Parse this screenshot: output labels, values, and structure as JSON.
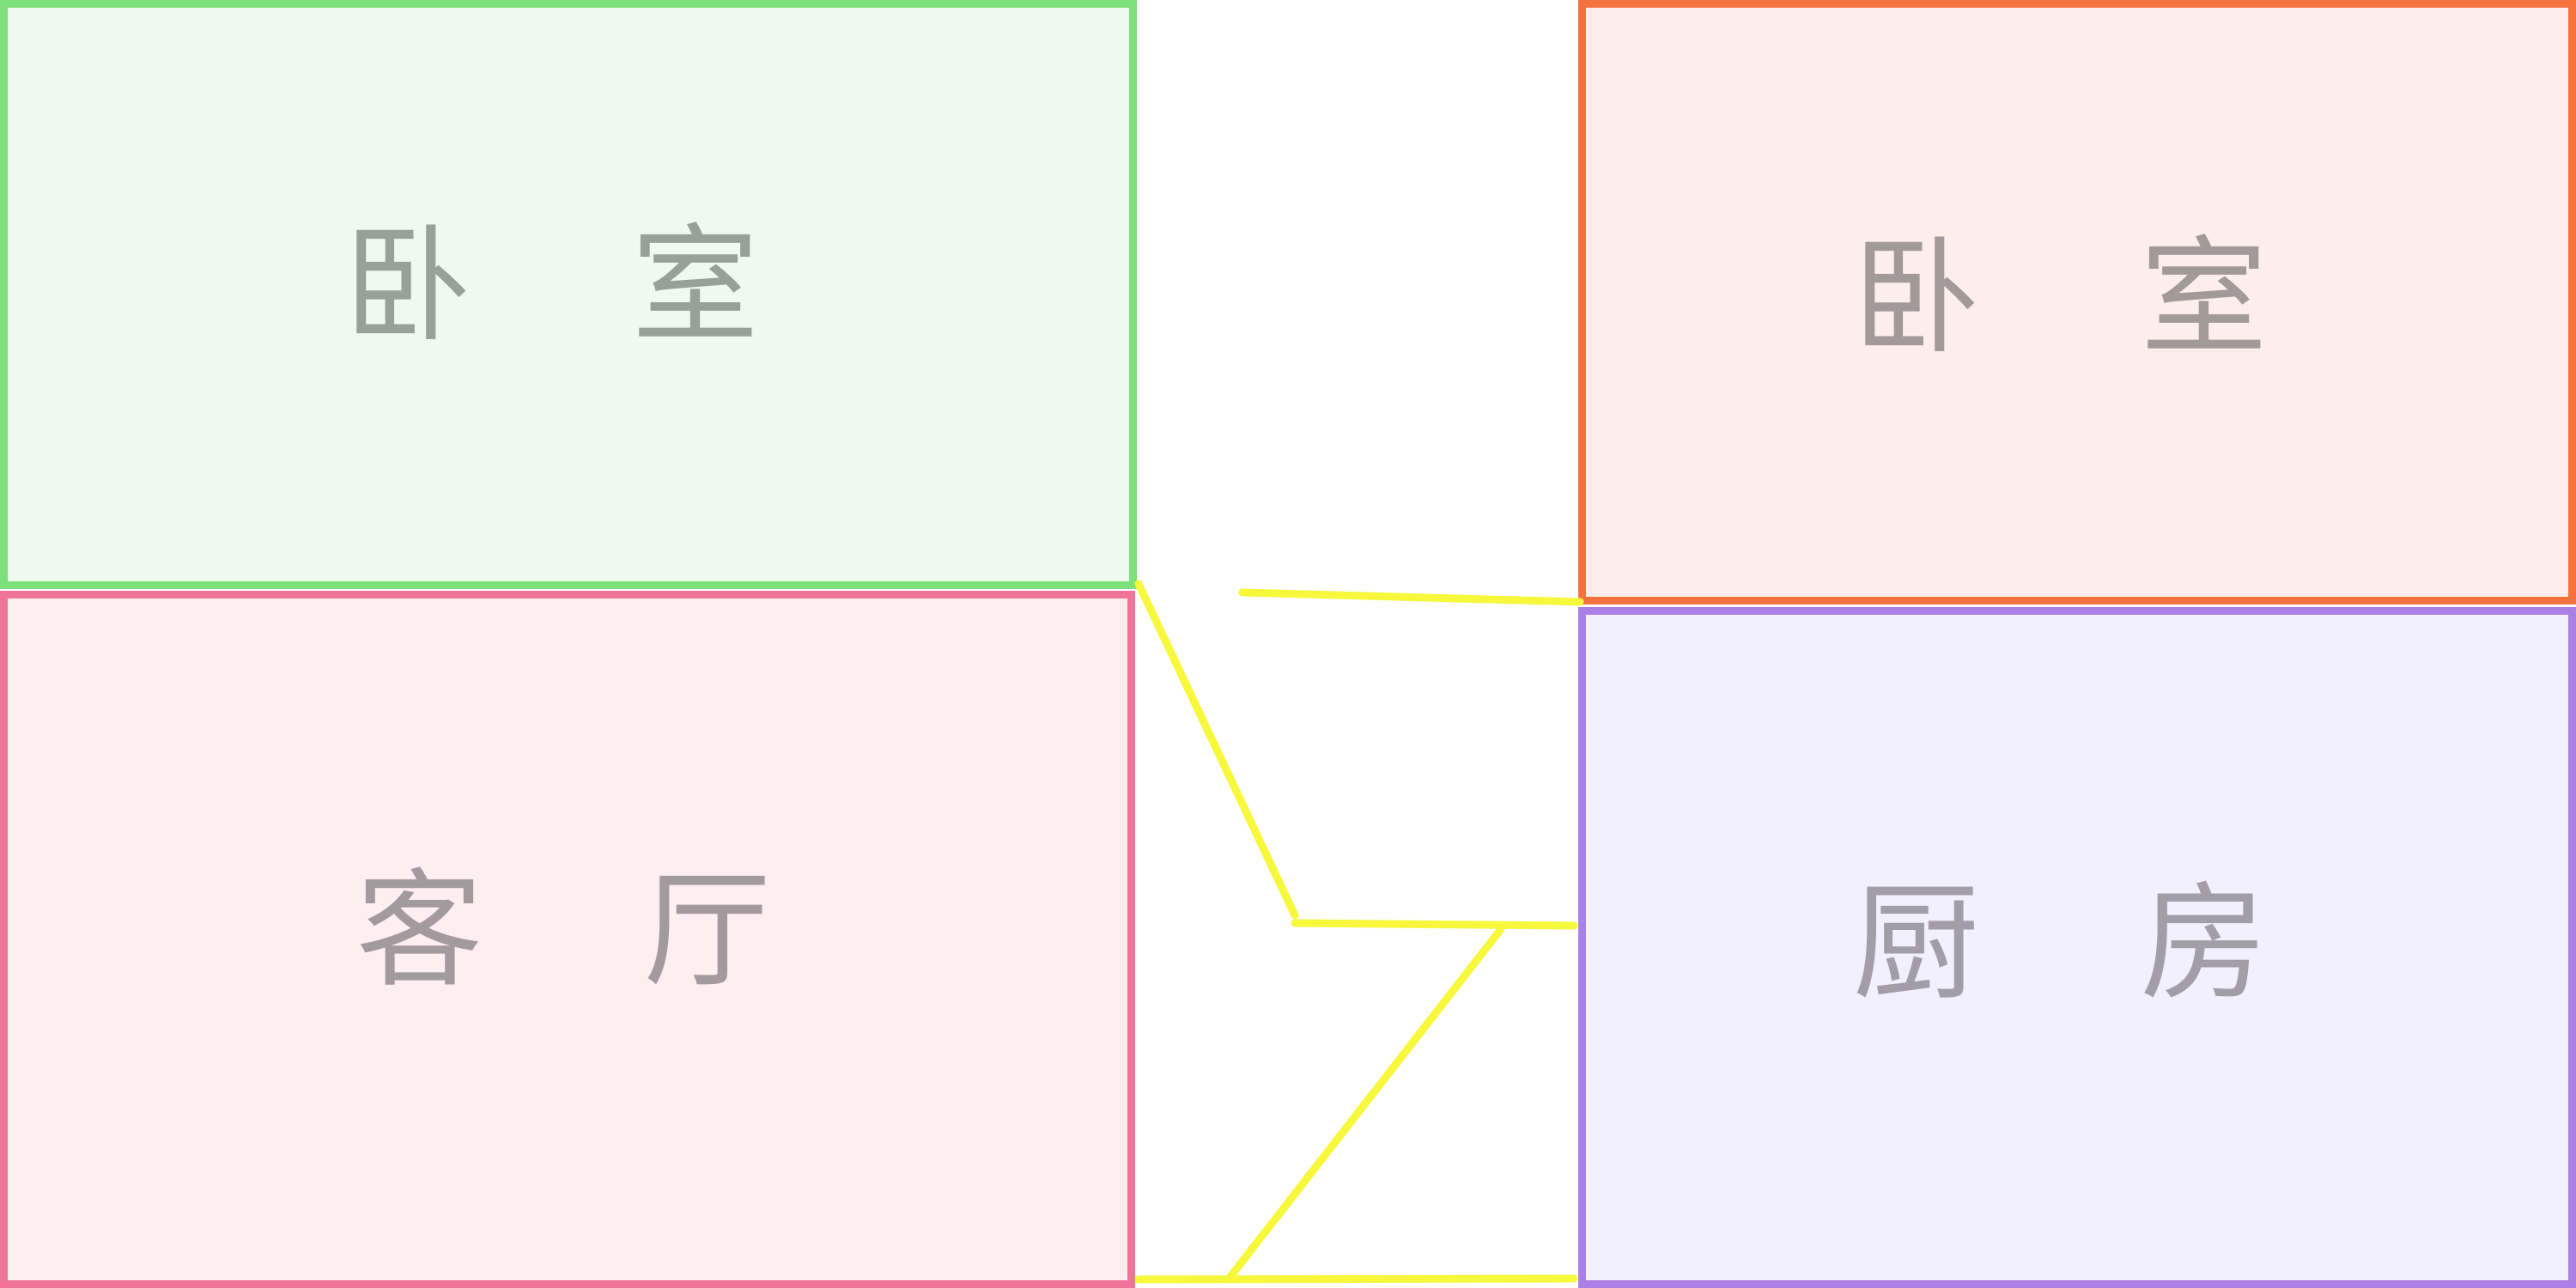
{
  "rooms": [
    {
      "id": "top-left",
      "label": "卧 室",
      "border_color": "#7ee07a",
      "fill_color": "#effaee",
      "text_color": "#97a296"
    },
    {
      "id": "top-right",
      "label": "卧 室",
      "border_color": "#f5723f",
      "fill_color": "#fdeeeb",
      "text_color": "#a29a99"
    },
    {
      "id": "bottom-left",
      "label": "客 厅",
      "border_color": "#ef7498",
      "fill_color": "#fdeef1",
      "text_color": "#a39a9d"
    },
    {
      "id": "bottom-right",
      "label": "厨 房",
      "border_color": "#aa80e6",
      "fill_color": "#f3f0fd",
      "text_color": "#a19ea8"
    }
  ],
  "connector_color": "#f7f73b"
}
